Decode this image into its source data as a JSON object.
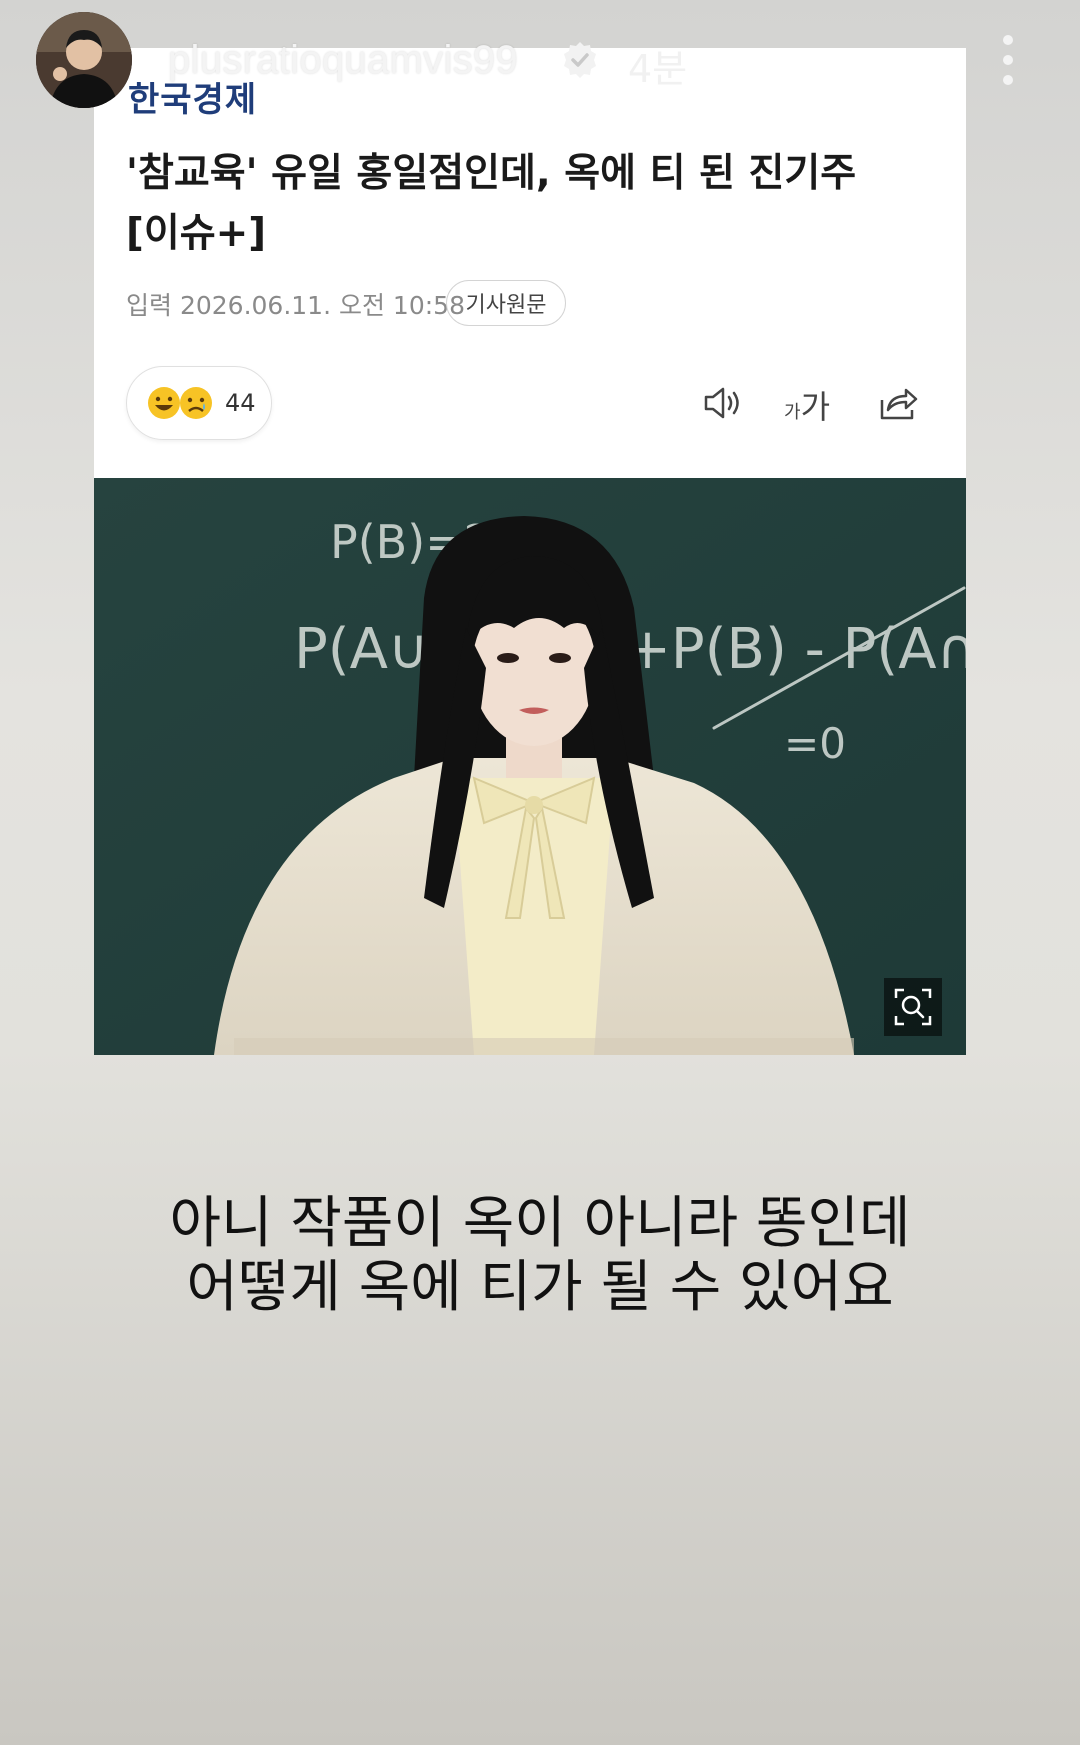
{
  "story": {
    "username": "plusratioquamvis99",
    "verified_icon": "verified-badge-icon",
    "time_ago": "4분",
    "more_icon": "more-vertical-icon"
  },
  "article": {
    "brand": "한국경제",
    "headline_line1": "'참교육' 유일 홍일점인데, 옥에 티 된 진기주",
    "headline_line2": "[이슈+]",
    "date": "입력 2026.06.11. 오전 10:58",
    "original_button": "기사원문",
    "reaction_count": "44",
    "font_size_small": "가",
    "font_size_large": "가",
    "tools": [
      "speaker-icon",
      "font-size-icon",
      "share-icon"
    ]
  },
  "photo": {
    "subject": "woman-in-front-of-chalkboard",
    "chalkboard_formula_top": "P(B)=?",
    "chalkboard_formula_left": "P(A∪",
    "chalkboard_formula_right": "+P(B) - P(A∩B)",
    "chalkboard_formula_eq": "=0",
    "zoom_icon": "zoom-search-icon"
  },
  "caption": {
    "line1": "아니 작품이 옥이 아니라 똥인데",
    "line2": "어떻게 옥에 티가 될 수 있어요"
  },
  "colors": {
    "brand": "#1f3d7a",
    "chalkboard": "#2a4a47"
  }
}
